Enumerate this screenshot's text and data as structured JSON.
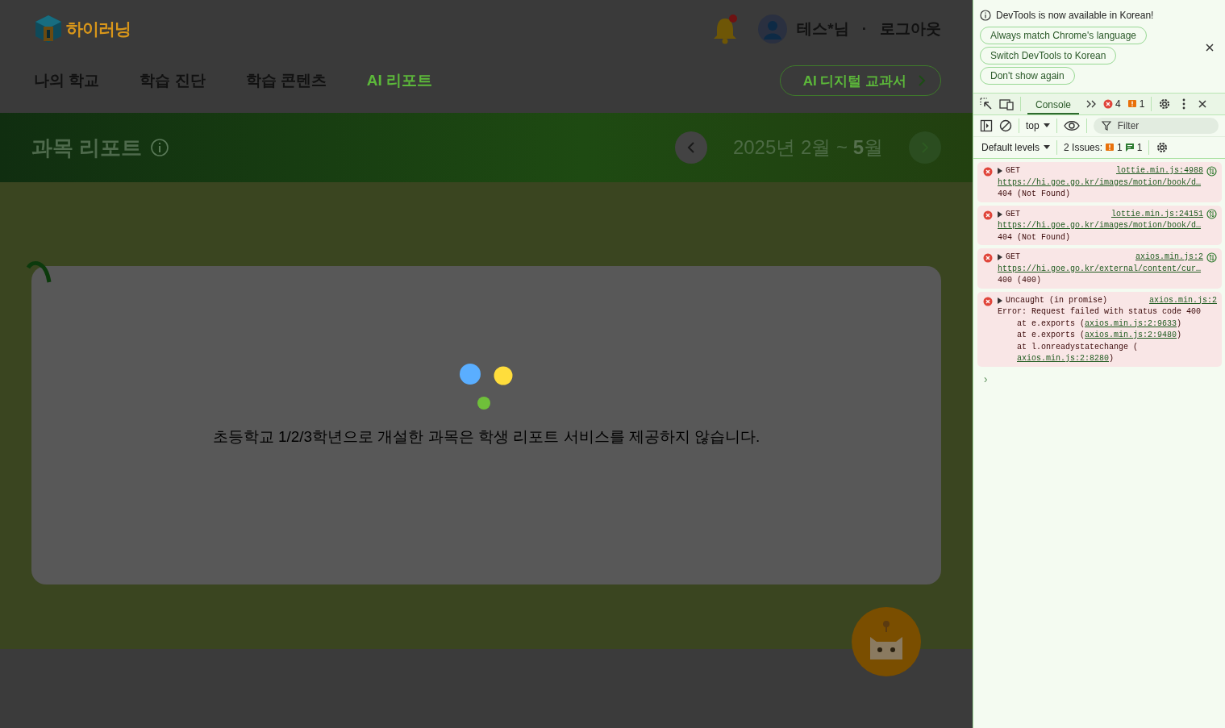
{
  "header": {
    "logo": "하이러닝",
    "notification": true,
    "user": "테스*님",
    "separator": "·",
    "logout": "로그아웃"
  },
  "nav": [
    {
      "label": "나의 학교",
      "selected": false
    },
    {
      "label": "학습 진단",
      "selected": false
    },
    {
      "label": "학습 콘텐츠",
      "selected": false
    },
    {
      "label": "AI 리포트",
      "selected": true
    }
  ],
  "textbook_button": "AI 디지털 교과서",
  "banner": {
    "title": "과목 리포트",
    "period": "2025년 2월 ~ **5**월",
    "next_disabled": true
  },
  "message": "초등학교 1/2/3학년으로 개설한 과목은 학생 리포트 서비스를 제공하지 않습니다.",
  "devtools": {
    "notice": "DevTools is now available in Korean!",
    "notice_buttons": [
      "Always match Chrome's language",
      "Switch DevTools to Korean",
      "Don't show again"
    ],
    "tabs": [
      {
        "label": "Console",
        "selected": true
      }
    ],
    "error_count": "4",
    "warning_count": "1",
    "context": "top",
    "filter_placeholder": "Filter",
    "levels": "Default levels",
    "issues_label": "2 Issues:",
    "issue_warning_count": "1",
    "issue_info_count": "1",
    "messages": [
      {
        "kind": "network",
        "summary": "GET",
        "source": "lottie.min.js:4988",
        "url": "https://hi.goe.go.kr/images/motion/book/d…",
        "status": "404 (Not Found)"
      },
      {
        "kind": "network",
        "summary": "GET",
        "source": "lottie.min.js:24151",
        "url": "https://hi.goe.go.kr/images/motion/book/d…",
        "status": "404 (Not Found)"
      },
      {
        "kind": "network",
        "summary": "GET",
        "source": "axios.min.js:2",
        "url": "https://hi.goe.go.kr/external/content/cur…",
        "status": "400 (400)"
      },
      {
        "kind": "exception",
        "summary": "Uncaught (in promise)",
        "source": "axios.min.js:2",
        "error": "Error: Request failed with status code 400",
        "stack": [
          {
            "prefix": "at e.exports (",
            "link": "axios.min.js:2:9633",
            "suffix": ")"
          },
          {
            "prefix": "at e.exports (",
            "link": "axios.min.js:2:9480",
            "suffix": ")"
          },
          {
            "prefix": "at l.onreadystatechange (",
            "link": "axios.min.js:2:8280",
            "suffix": ")"
          }
        ]
      }
    ],
    "prompt": "›"
  }
}
